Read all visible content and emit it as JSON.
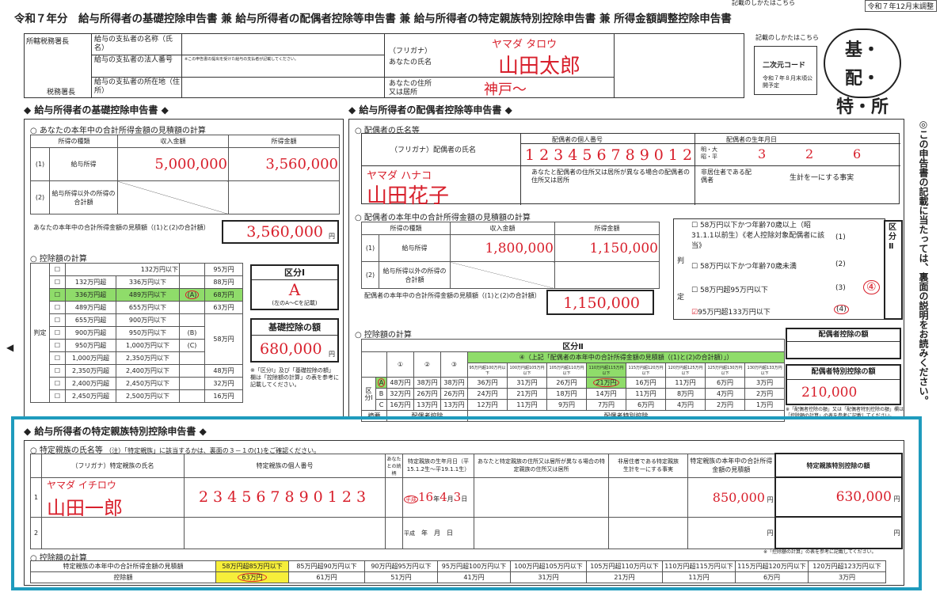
{
  "top_right": "令和７年12月末調整",
  "title": "令和７年分　給与所得者の基礎控除申告書 兼 給与所得者の配偶者控除等申告書 兼 給与所得者の特定親族特別控除申告書 兼 所得金額調整控除申告書",
  "header": {
    "office": "所轄税務署長",
    "office_suffix": "税務署長",
    "payer_name": "給与の支払者の名称（氏名）",
    "payer_number": "給与の支払者の法人番号",
    "payer_number_note": "※この申告書の提出を受けた給与の支払者が記載してください。",
    "payer_address": "給与の支払者の所在地（住所）",
    "furigana_label": "（フリガナ）",
    "name_label": "あなたの氏名",
    "address_label": "あなたの住所又は居所",
    "furigana": "ヤマダ タロウ",
    "name": "山田太郎",
    "address": "神戸〜",
    "howto": "記載のしかたはこちら",
    "qr": "二次元コード",
    "qr_note": "令和７年８月末頃公開予定",
    "badge": "基・配・特・所"
  },
  "basic": {
    "title": "◆ 給与所得者の基礎控除申告書 ◆",
    "sub1": "○ あなたの本年中の合計所得金額の見積額の計算",
    "th": [
      "所得の種類",
      "収入金額",
      "所得金額"
    ],
    "r1_label": "給与所得",
    "r1_income": "5,000,000",
    "r1_amount": "3,560,000",
    "r2_label": "給与所得以外の所得の合計額",
    "total_label": "あなたの本年中の合計所得金額の見積額（(1)と(2)の合計額）",
    "total": "3,560,000",
    "yen": "円",
    "sub2": "○ 控除額の計算",
    "rows": [
      [
        "132万円以下",
        "95万円"
      ],
      [
        "132万円超",
        "336万円以下",
        "88万円"
      ],
      [
        "336万円超",
        "489万円以下",
        "68万円"
      ],
      [
        "489万円超",
        "655万円以下",
        "63万円"
      ],
      [
        "655万円超",
        "900万円以下"
      ],
      [
        "900万円超",
        "950万円以下"
      ],
      [
        "950万円超",
        "1,000万円以下"
      ],
      [
        "1,000万円超",
        "2,350万円以下"
      ],
      [
        "2,350万円超",
        "2,400万円以下",
        "48万円"
      ],
      [
        "2,400万円超",
        "2,450万円以下",
        "32万円"
      ],
      [
        "2,450万円超",
        "2,500万円以下",
        "16万円"
      ]
    ],
    "b_label": "(B)",
    "c_label": "(C)",
    "amt_58": "58万円",
    "a_label": "(A)",
    "hantei": "判定",
    "kubun1": "区分Ⅰ",
    "kubun1_val": "A",
    "kubun1_note": "(左のA～Cを記載)",
    "deduction_label": "基礎控除の額",
    "deduction": "680,000",
    "note": "※「区分Ⅰ」及び「基礎控除の額」欄は「控除額の計算」の表を参考に記載してください。"
  },
  "spouse": {
    "title": "◆ 給与所得者の配偶者控除等申告書 ◆",
    "sub1": "○ 配偶者の氏名等",
    "furigana_label": "（フリガナ）配偶者の氏名",
    "number_label": "配偶者の個人番号",
    "birth_label": "配偶者の生年月日",
    "furigana": "ヤマダ ハナコ",
    "name": "山田花子",
    "number": "123456789012",
    "birth_era": "明・大 昭・平",
    "birth_y": "3",
    "birth_m": "2",
    "birth_d": "6",
    "addr_label": "あなたと配偶者の住所又は居所が異なる場合の配偶者の住所又は居所",
    "nonres_label": "非居住者である配偶者",
    "living_label": "生計を一にする事実",
    "sub2": "○ 配偶者の本年中の合計所得金額の見積額の計算",
    "th": [
      "所得の種類",
      "収入金額",
      "所得金額"
    ],
    "r1_label": "給与所得",
    "r1_income": "1,800,000",
    "r1_amount": "1,150,000",
    "r2_label": "給与所得以外の所得の合計額",
    "total_label": "配偶者の本年中の合計所得金額の見積額（(1)と(2)の合計額）",
    "total": "1,150,000",
    "judge": [
      "58万円以下かつ年齢70歳以上（昭31.1.1以前生）《老人控除対象配偶者に該当》",
      "58万円以下かつ年齢70歳未満",
      "58万円超95万円以下",
      "95万円超133万円以下"
    ],
    "judge_nums": [
      "(1)",
      "(2)",
      "(3)",
      "(4)"
    ],
    "judge_side": "判定",
    "kubun2": "区分Ⅱ",
    "kubun2_val": "④",
    "sub3": "○ 控除額の計算",
    "kubun_table_title": "区分Ⅱ",
    "green_header": "④（上記「配偶者の本年中の合計所得金額の見積額（(1)と(2)の合計額）」）",
    "cols": [
      "①",
      "②",
      "③"
    ],
    "bands": [
      "95万円超100万円以下",
      "100万円超105万円以下",
      "105万円超110万円以下",
      "110万円超115万円以下",
      "115万円超120万円以下",
      "120万円超125万円以下",
      "125万円超130万円以下",
      "130万円超133万円以下"
    ],
    "rowA": [
      "48万円",
      "38万円",
      "38万円",
      "36万円",
      "31万円",
      "26万円",
      "21万円",
      "16万円",
      "11万円",
      "6万円",
      "3万円"
    ],
    "rowB": [
      "32万円",
      "26万円",
      "26万円",
      "24万円",
      "21万円",
      "18万円",
      "14万円",
      "11万円",
      "8万円",
      "4万円",
      "2万円"
    ],
    "rowC": [
      "16万円",
      "13万円",
      "13万円",
      "12万円",
      "11万円",
      "9万円",
      "7万円",
      "6万円",
      "4万円",
      "2万円",
      "1万円"
    ],
    "row_labels": [
      "A",
      "B",
      "C"
    ],
    "kubun_side": "区分Ⅰ",
    "foot": [
      "摘要",
      "配偶者控除",
      "配偶者特別控除"
    ],
    "ded_label": "配偶者控除の額",
    "sp_label": "配偶者特別控除の額",
    "sp_amount": "210,000",
    "note": "※「配偶者控除の額」又は「配偶者特別控除の額」欄は「控除額の計算」の表を参考に記載してください。"
  },
  "vertical_note": "◎この申告書の記載に当たっては、裏面の説明をお読みください。",
  "relative": {
    "title": "◆ 給与所得者の特定親族特別控除申告書 ◆",
    "sub1": "○ 特定親族の氏名等",
    "sub1_note": "（注）「特定親族」に該当するかは、裏面の３－１の(1)をご確認ください。",
    "furigana_label": "（フリガナ）特定親族の氏名",
    "number_label": "特定親族の個人番号",
    "rel_label": "あなたとの続柄",
    "birth_label": "特定親族の生年月日（平15.1.2生～平19.1.1生）",
    "addr_label": "あなたと特定親族の住所又は居所が異なる場合の特定親族の住所又は居所",
    "nonres_label": "非居住者である特定親族",
    "living_label": "生計を一にする事実",
    "income_label": "特定親族の本年中の合計所得金額の見積額",
    "ded_label": "特定親族特別控除の額",
    "row1_no": "1",
    "row2_no": "2",
    "furigana": "ヤマダ イチロウ",
    "name": "山田一郎",
    "number": "234567890123",
    "era": "平成",
    "birth_y": "16",
    "birth_m": "4",
    "birth_d": "3",
    "income": "850,000",
    "deduction": "630,000",
    "era2": "平成",
    "year_l": "年",
    "month_l": "月",
    "day_l": "日",
    "yen": "円",
    "sub2": "○ 控除額の計算",
    "sub2_note": "※「控除額の計算」の表を参考に記載してください。",
    "calc_head": "特定親族の本年中の合計所得金額の見積額",
    "calc_ded": "控除額",
    "bands": [
      "58万円超85万円以下",
      "85万円超90万円以下",
      "90万円超95万円以下",
      "95万円超100万円以下",
      "100万円超105万円以下",
      "105万円超110万円以下",
      "110万円超115万円以下",
      "115万円超120万円以下",
      "120万円超123万円以下"
    ],
    "amounts": [
      "63万円",
      "61万円",
      "51万円",
      "41万円",
      "31万円",
      "21万円",
      "11万円",
      "6万円",
      "3万円"
    ]
  }
}
